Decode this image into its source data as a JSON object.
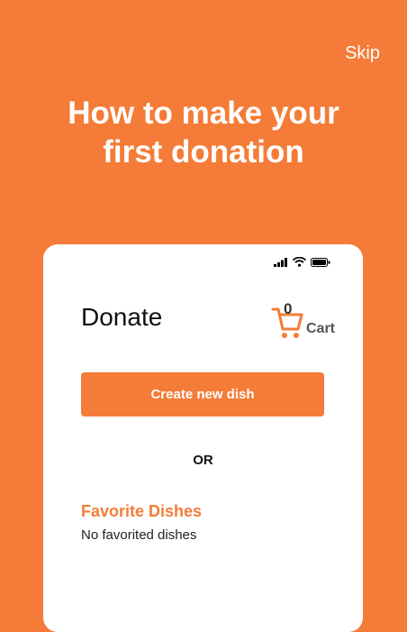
{
  "header": {
    "skip_label": "Skip",
    "title_line1": "How to make your",
    "title_line2": "first donation"
  },
  "phone": {
    "status_icons": [
      "signal-icon",
      "wifi-icon",
      "battery-icon"
    ],
    "page_title": "Donate",
    "cart": {
      "count": "0",
      "label": "Cart",
      "icon": "cart-icon"
    },
    "create_button_label": "Create new dish",
    "or_label": "OR",
    "favorites": {
      "title": "Favorite Dishes",
      "empty_text": "No favorited dishes"
    }
  },
  "colors": {
    "accent": "#F47C38",
    "card": "#FFFFFF"
  }
}
